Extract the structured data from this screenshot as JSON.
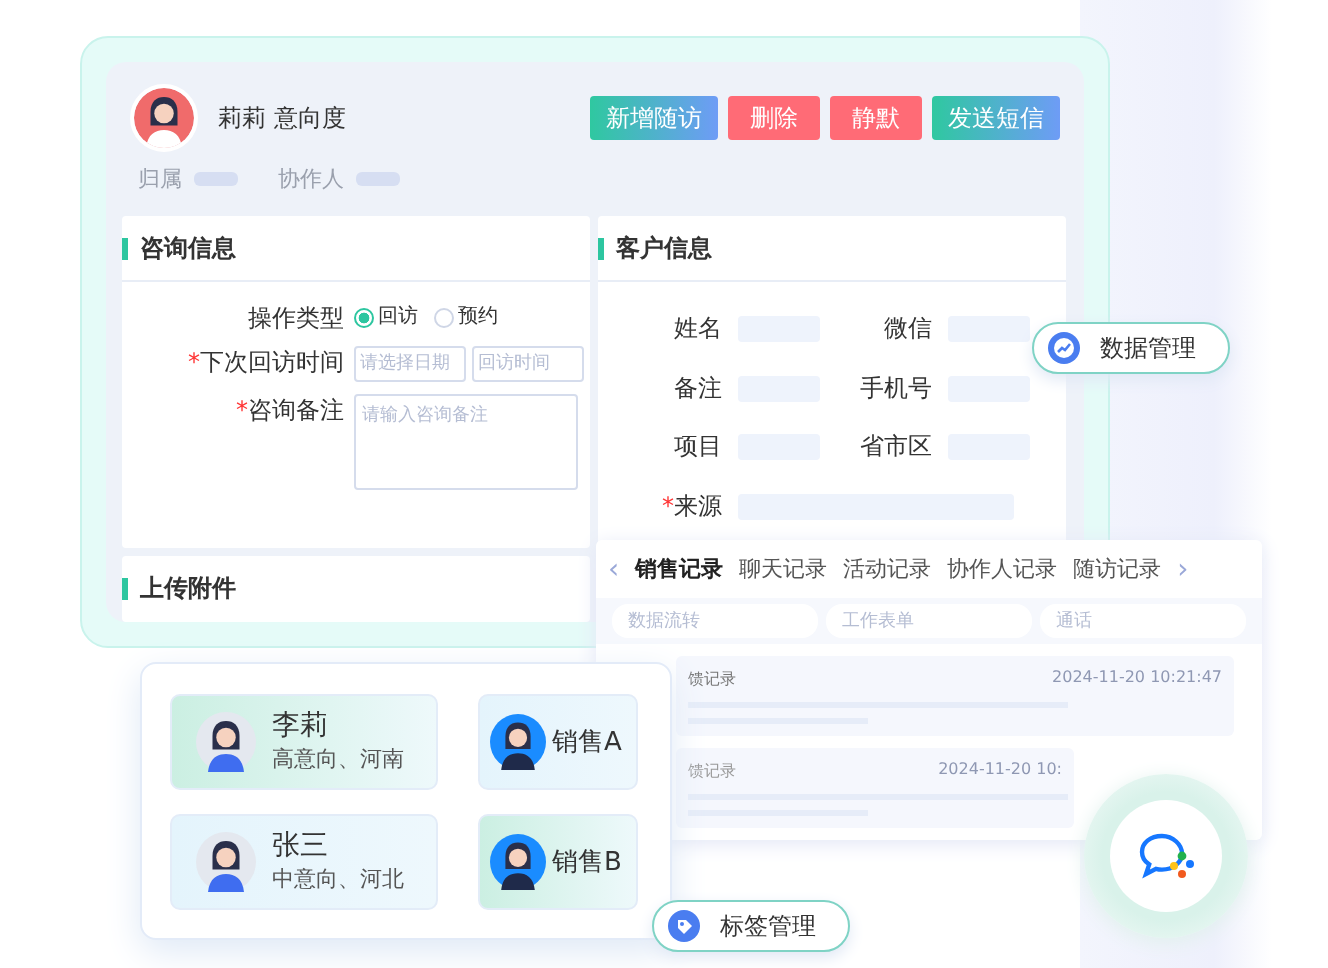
{
  "header": {
    "name": "莉莉",
    "label": "意向度",
    "buttons": [
      {
        "label": "新增随访",
        "kind": "primary"
      },
      {
        "label": "删除",
        "kind": "danger"
      },
      {
        "label": "静默",
        "kind": "danger"
      },
      {
        "label": "发送短信",
        "kind": "primary"
      }
    ],
    "meta": [
      {
        "label": "归属"
      },
      {
        "label": "协作人"
      }
    ]
  },
  "consult": {
    "title": "咨询信息",
    "fields": [
      {
        "kind": "radio",
        "label": "操作类型",
        "options": [
          {
            "label": "回访",
            "selected": true
          },
          {
            "label": "预约",
            "selected": false
          }
        ]
      },
      {
        "kind": "pair",
        "mark": "*",
        "label": "下次回访时间",
        "placeholders": [
          "请选择日期",
          "回访时间"
        ]
      },
      {
        "kind": "textarea",
        "mark": "*",
        "label": "咨询备注",
        "placeholder": "请输入咨询备注"
      }
    ]
  },
  "customer": {
    "title": "客户信息",
    "fields": [
      {
        "kind": "half",
        "label": "姓名"
      },
      {
        "kind": "half",
        "label": "微信"
      },
      {
        "kind": "half",
        "label": "备注"
      },
      {
        "kind": "half",
        "label": "手机号"
      },
      {
        "kind": "half",
        "label": "项目"
      },
      {
        "kind": "half",
        "label": "省市区"
      },
      {
        "kind": "full",
        "mark": "*",
        "label": "来源"
      }
    ]
  },
  "upload": {
    "title": "上传附件"
  },
  "records": {
    "prev": "‹",
    "next": "›",
    "tabs": [
      {
        "label": "销售记录",
        "selected": true
      },
      {
        "label": "聊天记录",
        "selected": false
      },
      {
        "label": "活动记录",
        "selected": false
      },
      {
        "label": "协作人记录",
        "selected": false
      },
      {
        "label": "随访记录",
        "selected": false
      }
    ],
    "filters": [
      "数据流转",
      "工作表单",
      "通话"
    ],
    "items": [
      {
        "title": "馈记录",
        "time": "2024-11-20 10:21:47"
      },
      {
        "title": "馈记录",
        "time": "2024-11-20 10:"
      }
    ]
  },
  "badges": [
    {
      "kind": "data",
      "label": "数据管理"
    },
    {
      "kind": "tag",
      "label": "标签管理"
    }
  ],
  "assign": {
    "customers": [
      {
        "kind": "mint",
        "name": "李莉",
        "info": "高意向、河南"
      },
      {
        "kind": "sky",
        "name": "张三",
        "info": "中意向、河北"
      }
    ],
    "sales": [
      {
        "kind": "sky",
        "name": "销售A"
      },
      {
        "kind": "mint",
        "name": "销售B"
      }
    ]
  }
}
